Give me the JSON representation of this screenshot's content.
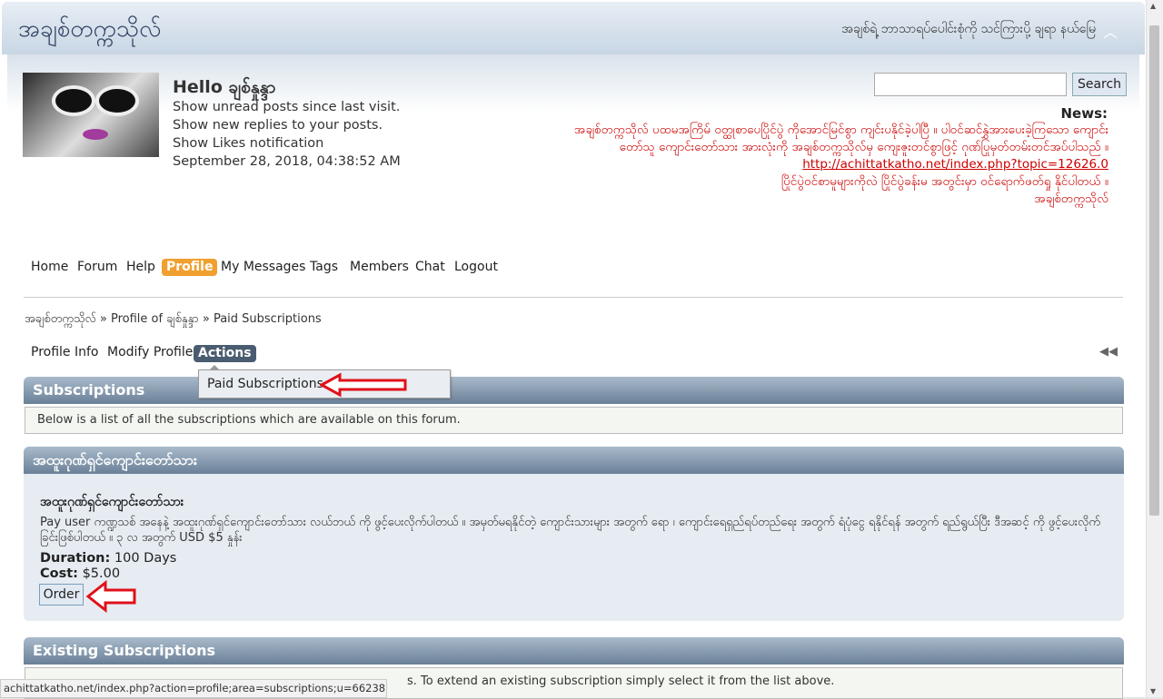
{
  "header": {
    "forum_title": "အချစ်တက္ကသိုလ်",
    "slogan": "အချစ်ရဲ့ ဘာသာရပ်ပေါင်းစုံကို သင်ကြားပို့ ချရာ နယ်မြေ"
  },
  "user": {
    "greeting": "Hello ချစ်နှုန္ဒာ",
    "links": [
      "Show unread posts since last visit.",
      "Show new replies to your posts.",
      "Show Likes notification"
    ],
    "datetime": "September 28, 2018, 04:38:52 AM"
  },
  "search": {
    "button_label": "Search",
    "value": ""
  },
  "news": {
    "title": "News:",
    "line1": "အချစ်တက္ကသိုလ် ပထမအကြိမ် ဝတ္ထုစာပေပြိုင်ပွဲ ကိုအောင်မြင်စွာ ကျင်းပနိုင်ခဲ့ပါပြီ ။ ပါဝင်ဆင်နွှဲအားပေးခဲ့ကြသော ကျောင်းတော်သူ ကျောင်းတော်သား အားလုံးကို အချစ်တက္ကသိုလ်မှ ကျေးဇူးတင်စွာဖြင့် ဂုဏ်ပြုမှတ်တမ်းတင်အပ်ပါသည် ။",
    "link": "http://achittatkatho.net/index.php?topic=12626.0",
    "line2": "ပြိုင်ပွဲဝင်စာမူများကိုလဲ ပြိုင်ပွဲခန်းမ အတွင်းမှာ ဝင်ရောက်ဖတ်ရှု နိုင်ပါတယ် ။",
    "signature": "အချစ်တက္ကသိုလ်"
  },
  "menu": {
    "items": [
      "Home",
      "Forum",
      "Help",
      "Profile",
      "My Messages",
      "Tags",
      "Members",
      "Chat",
      "Logout"
    ],
    "active": "Profile"
  },
  "breadcrumb": {
    "items": [
      "အချစ်တက္ကသိုလ်",
      "Profile of ချစ်နှုန္ဒာ",
      "Paid Subscriptions"
    ],
    "separator": "»"
  },
  "profile_menu": {
    "items": [
      "Profile Info",
      "Modify Profile",
      "Actions"
    ],
    "active": "Actions",
    "dropdown_item": "Paid Subscriptions"
  },
  "subscriptions": {
    "header": "Subscriptions",
    "info": "Below is a list of all the subscriptions which are available on this forum."
  },
  "subscription": {
    "category": "အထူးဂုဏ်ရှင်ကျောင်းတော်သား",
    "name": "အထူးဂုဏ်ရှင်ကျောင်းတော်သား",
    "description": "Pay user ကဏ္ဍသစ် အနေနဲ့ အထူးဂုဏ်ရှင်ကျောင်းတော်သား လယ်ဘယ် ကို ဖွင့်ပေးလိုက်ပါတယ် ။ အမှတ်မရနိုင်တဲ့ ကျောင်းသားများ အတွက် ရော ၊ ကျောင်းရေရှည်ရပ်တည်ရေး အတွက် ရံပုံငွေ ရနိုင်ရန် အတွက် ရည်ရွယ်ပြီး ဒီအဆင့် ကို ဖွင့်ပေးလိုက်ခြင်းဖြစ်ပါတယ် ။ ၃ လ အတွက် USD $5 နှုန်း",
    "duration_label": "Duration:",
    "duration_value": "100 Days",
    "cost_label": "Cost:",
    "cost_value": "$5.00",
    "order_label": "Order"
  },
  "existing": {
    "header": "Existing Subscriptions",
    "info": "s. To extend an existing subscription simply select it from the list above."
  },
  "status_bar": {
    "url": "achittatkatho.net/index.php?action=profile;area=subscriptions;u=66238"
  },
  "colors": {
    "accent_orange": "#f0a030",
    "bar_blue": "#6a8098",
    "news_red": "#cc0000",
    "annotation_arrow": "#e0101a"
  }
}
